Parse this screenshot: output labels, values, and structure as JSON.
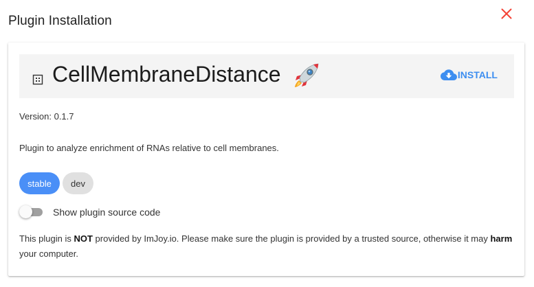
{
  "dialog": {
    "title": "Plugin Installation",
    "close_icon": "close-icon"
  },
  "plugin": {
    "name": "CellMembraneDistance",
    "icon": "plugin-icon",
    "emoji_icon": "rocket-icon",
    "install_label": "INSTALL",
    "install_icon": "cloud-download-icon",
    "version_text": "Version: 0.1.7",
    "description": "Plugin to analyze enrichment of RNAs relative to cell membranes."
  },
  "tags": {
    "stable": "stable",
    "dev": "dev",
    "selected": "stable"
  },
  "source_toggle": {
    "label": "Show plugin source code",
    "checked": false
  },
  "warning": {
    "part1": "This plugin is ",
    "not": "NOT",
    "part2": " provided by ImJoy.io. Please make sure the plugin is provided by a trusted source, otherwise it may ",
    "harm": "harm",
    "part3": " your computer."
  },
  "colors": {
    "accent": "#4a8ff7",
    "install": "#3d8ef0",
    "close": "#f44336",
    "header_bg": "#f4f4f4"
  }
}
